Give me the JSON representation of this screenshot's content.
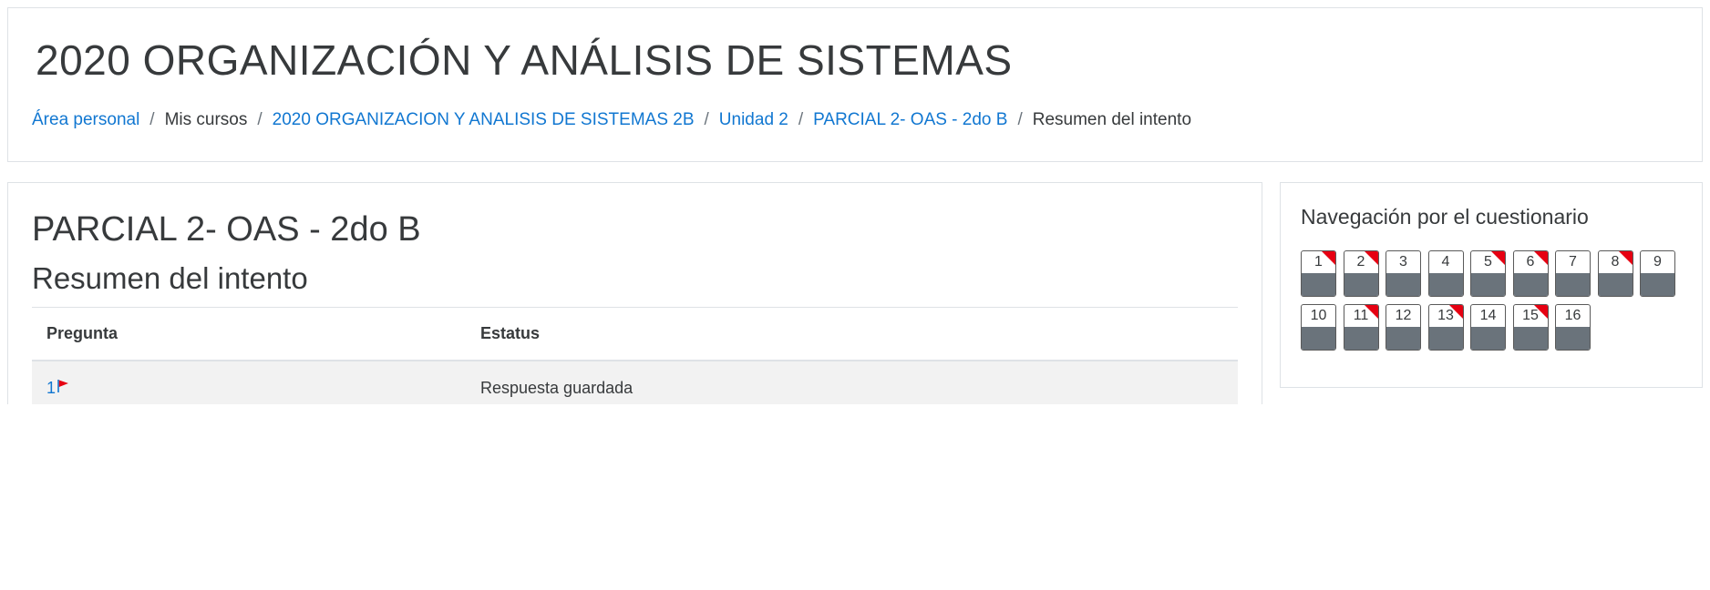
{
  "header": {
    "course_title": "2020 ORGANIZACIÓN Y ANÁLISIS DE SISTEMAS",
    "breadcrumb": [
      {
        "label": "Área personal",
        "link": true
      },
      {
        "label": "Mis cursos",
        "link": false
      },
      {
        "label": "2020 ORGANIZACION Y ANALISIS DE SISTEMAS 2B",
        "link": true
      },
      {
        "label": "Unidad 2",
        "link": true
      },
      {
        "label": "PARCIAL 2- OAS - 2do B",
        "link": true
      },
      {
        "label": "Resumen del intento",
        "link": false
      }
    ],
    "separator": "/"
  },
  "main": {
    "quiz_name": "PARCIAL 2- OAS - 2do B",
    "section_title": "Resumen del intento",
    "table": {
      "headers": [
        "Pregunta",
        "Estatus"
      ],
      "rows": [
        {
          "question": "1",
          "flagged": true,
          "status": "Respuesta guardada"
        }
      ]
    }
  },
  "sidebar": {
    "title": "Navegación por el cuestionario",
    "questions": [
      {
        "num": "1",
        "flagged": true
      },
      {
        "num": "2",
        "flagged": true
      },
      {
        "num": "3",
        "flagged": false
      },
      {
        "num": "4",
        "flagged": false
      },
      {
        "num": "5",
        "flagged": true
      },
      {
        "num": "6",
        "flagged": true
      },
      {
        "num": "7",
        "flagged": false
      },
      {
        "num": "8",
        "flagged": true
      },
      {
        "num": "9",
        "flagged": false
      },
      {
        "num": "10",
        "flagged": false
      },
      {
        "num": "11",
        "flagged": true
      },
      {
        "num": "12",
        "flagged": false
      },
      {
        "num": "13",
        "flagged": true
      },
      {
        "num": "14",
        "flagged": false
      },
      {
        "num": "15",
        "flagged": true
      },
      {
        "num": "16",
        "flagged": false
      }
    ]
  },
  "colors": {
    "link": "#1177d1",
    "flag": "#e60012",
    "answered_fill": "#6a737b",
    "row_bg": "#f2f2f2"
  }
}
